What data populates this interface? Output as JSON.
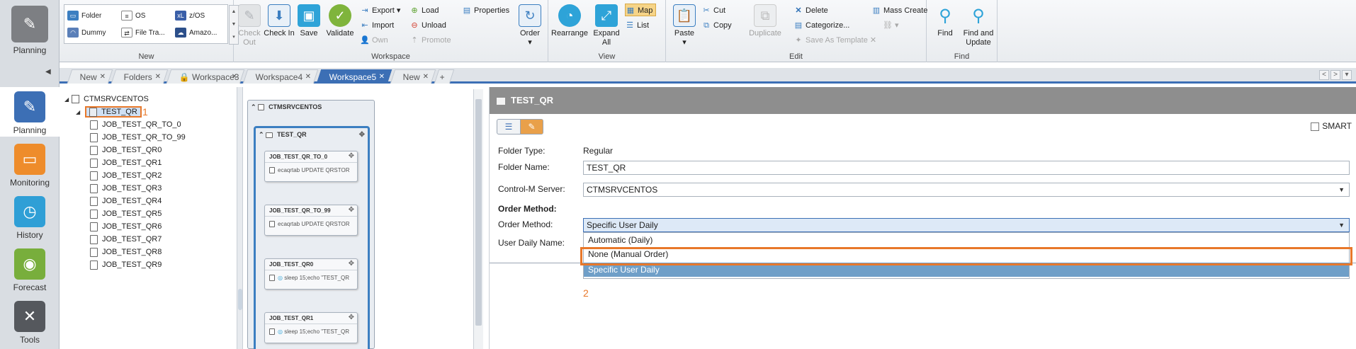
{
  "rail": {
    "top_label": "Planning",
    "items": [
      {
        "label": "Planning"
      },
      {
        "label": "Monitoring"
      },
      {
        "label": "History"
      },
      {
        "label": "Forecast"
      },
      {
        "label": "Tools"
      }
    ]
  },
  "ribbon": {
    "new_group": {
      "label": "New",
      "items": [
        "Folder",
        "OS",
        "z/OS",
        "Dummy",
        "File Tra...",
        "Amazo..."
      ]
    },
    "workspace_group": {
      "label": "Workspace",
      "check_out": "Check Out",
      "check_in": "Check In",
      "save": "Save",
      "validate": "Validate",
      "export": "Export",
      "import": "Import",
      "own": "Own",
      "load": "Load",
      "unload": "Unload",
      "promote": "Promote",
      "properties": "Properties",
      "order": "Order"
    },
    "view_group": {
      "label": "View",
      "rearrange": "Rearrange",
      "expand_all": "Expand All",
      "map": "Map",
      "list": "List"
    },
    "edit_group": {
      "label": "Edit",
      "paste": "Paste",
      "cut": "Cut",
      "copy": "Copy",
      "duplicate": "Duplicate",
      "delete": "Delete",
      "categorize": "Categorize...",
      "save_as_template": "Save As Template",
      "mass_create": "Mass Create"
    },
    "find_group": {
      "label": "Find",
      "find": "Find",
      "find_update": "Find and Update"
    }
  },
  "tabs": [
    {
      "label": "New"
    },
    {
      "label": "Folders"
    },
    {
      "label": "Workspace3"
    },
    {
      "label": "Workspace4"
    },
    {
      "label": "Workspace5"
    },
    {
      "label": "New"
    }
  ],
  "tree": {
    "root": "CTMSRVCENTOS",
    "folder": "TEST_QR",
    "folder_callout": "1",
    "jobs": [
      "JOB_TEST_QR_TO_0",
      "JOB_TEST_QR_TO_99",
      "JOB_TEST_QR0",
      "JOB_TEST_QR1",
      "JOB_TEST_QR2",
      "JOB_TEST_QR3",
      "JOB_TEST_QR4",
      "JOB_TEST_QR5",
      "JOB_TEST_QR6",
      "JOB_TEST_QR7",
      "JOB_TEST_QR8",
      "JOB_TEST_QR9"
    ]
  },
  "map": {
    "server": "CTMSRVCENTOS",
    "folder": "TEST_QR",
    "cards": [
      {
        "title": "JOB_TEST_QR_TO_0",
        "cmd": "ecaqrtab UPDATE QRSTOR"
      },
      {
        "title": "JOB_TEST_QR_TO_99",
        "cmd": "ecaqrtab UPDATE QRSTOR"
      },
      {
        "title": "JOB_TEST_QR0",
        "cmd": "sleep 15;echo \"TEST_QR"
      },
      {
        "title": "JOB_TEST_QR1",
        "cmd": "sleep 15;echo \"TEST_QR"
      }
    ]
  },
  "props": {
    "title": "TEST_QR",
    "smart": "SMART",
    "folder_type_label": "Folder Type:",
    "folder_type_value": "Regular",
    "folder_name_label": "Folder Name:",
    "folder_name_value": "TEST_QR",
    "server_label": "Control-M Server:",
    "server_value": "CTMSRVCENTOS",
    "order_method_section": "Order Method:",
    "order_method_label": "Order Method:",
    "order_method_value": "Specific User Daily",
    "user_daily_label": "User Daily Name:",
    "options": [
      "Automatic (Daily)",
      "None (Manual Order)",
      "Specific User Daily"
    ],
    "option_callout": "2"
  }
}
